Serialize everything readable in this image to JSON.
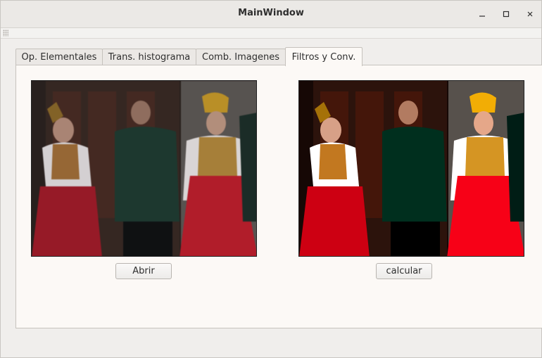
{
  "window": {
    "title": "MainWindow",
    "controls": {
      "minimize": "–",
      "maximize": "☐",
      "close": "✕"
    }
  },
  "tabs": [
    {
      "label": "Op. Elementales",
      "active": false
    },
    {
      "label": "Trans. histograma",
      "active": false
    },
    {
      "label": "Comb. Imagenes",
      "active": false
    },
    {
      "label": "Filtros y Conv.",
      "active": true
    }
  ],
  "buttons": {
    "open_label": "Abrir",
    "compute_label": "calcular"
  },
  "images": {
    "source": "photo of three costumed dancers (original)",
    "result": "photo of three costumed dancers (filtered, sharper)"
  }
}
